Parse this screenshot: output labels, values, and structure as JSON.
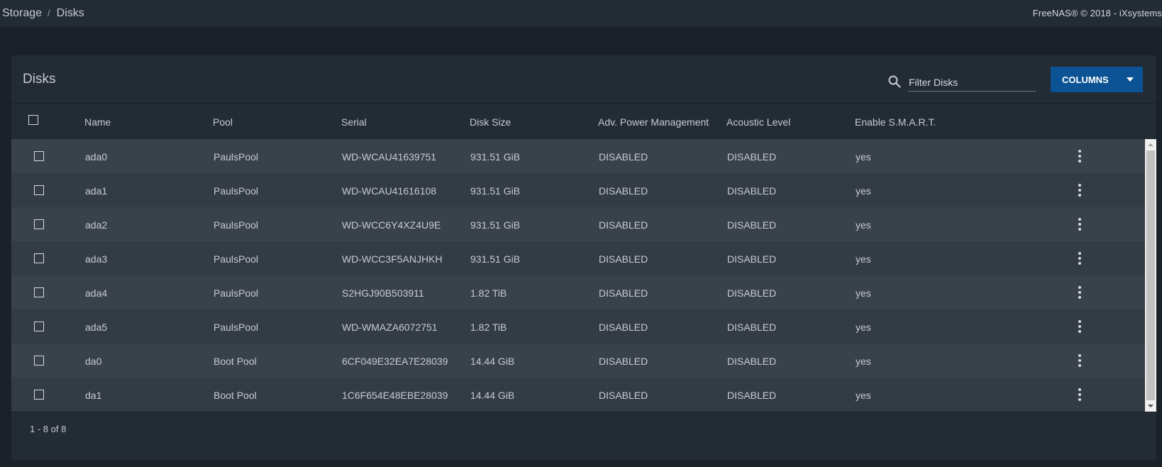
{
  "breadcrumb": {
    "parent": "Storage",
    "separator": "/",
    "current": "Disks"
  },
  "copyright": "FreeNAS® © 2018 - iXsystems",
  "card": {
    "title": "Disks",
    "filter_placeholder": "Filter Disks",
    "columns_button": "COLUMNS"
  },
  "table": {
    "headers": [
      "Name",
      "Pool",
      "Serial",
      "Disk Size",
      "Adv. Power Management",
      "Acoustic Level",
      "Enable S.M.A.R.T."
    ],
    "rows": [
      [
        "ada0",
        "PaulsPool",
        "WD-WCAU41639751",
        "931.51 GiB",
        "DISABLED",
        "DISABLED",
        "yes"
      ],
      [
        "ada1",
        "PaulsPool",
        "WD-WCAU41616108",
        "931.51 GiB",
        "DISABLED",
        "DISABLED",
        "yes"
      ],
      [
        "ada2",
        "PaulsPool",
        "WD-WCC6Y4XZ4U9E",
        "931.51 GiB",
        "DISABLED",
        "DISABLED",
        "yes"
      ],
      [
        "ada3",
        "PaulsPool",
        "WD-WCC3F5ANJHKH",
        "931.51 GiB",
        "DISABLED",
        "DISABLED",
        "yes"
      ],
      [
        "ada4",
        "PaulsPool",
        "S2HGJ90B503911",
        "1.82 TiB",
        "DISABLED",
        "DISABLED",
        "yes"
      ],
      [
        "ada5",
        "PaulsPool",
        "WD-WMAZA6072751",
        "1.82 TiB",
        "DISABLED",
        "DISABLED",
        "yes"
      ],
      [
        "da0",
        "Boot Pool",
        "6CF049E32EA7E28039",
        "14.44 GiB",
        "DISABLED",
        "DISABLED",
        "yes"
      ],
      [
        "da1",
        "Boot Pool",
        "1C6F654E48EBE28039",
        "14.44 GiB",
        "DISABLED",
        "DISABLED",
        "yes"
      ]
    ]
  },
  "paginator": "1 - 8 of 8",
  "colors": {
    "background": "#1b2129",
    "panel": "#232b34",
    "row_light": "#39414a",
    "row_dark": "#333b44",
    "accent": "#0b5394"
  },
  "icons": [
    "search-icon",
    "caret-down-icon",
    "more-vert-icon",
    "checkbox-icon"
  ]
}
